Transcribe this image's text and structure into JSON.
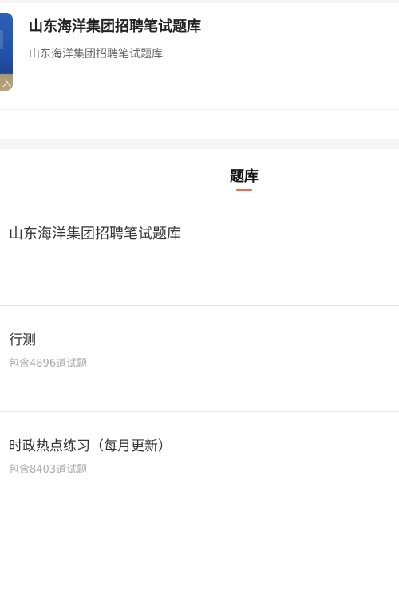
{
  "header": {
    "cover_text": "入",
    "title": "山东海洋集团招聘笔试题库",
    "subtitle": "山东海洋集团招聘笔试题库"
  },
  "tabs": [
    {
      "label": "题库",
      "active": true
    }
  ],
  "bank": {
    "name": "山东海洋集团招聘笔试题库"
  },
  "subjects": [
    {
      "name": "行测",
      "count_text": "包含4896道试题"
    },
    {
      "name": "时政热点练习（每月更新）",
      "count_text": "包含8403道试题"
    }
  ],
  "colors": {
    "accent": "#ef6a4c",
    "cover_blue": "#2250a8"
  }
}
